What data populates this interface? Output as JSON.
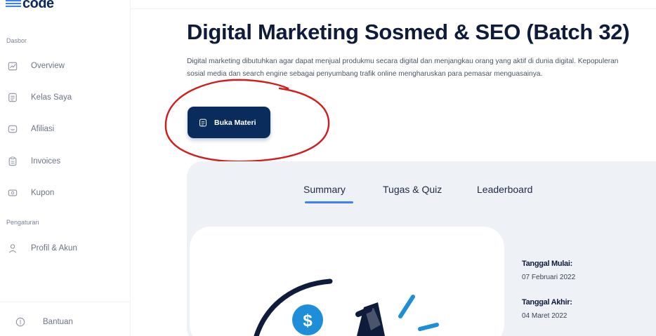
{
  "app": {
    "logo_text": "code"
  },
  "sidebar": {
    "section_dasbor": "Dasbor",
    "section_pengaturan": "Pengaturan",
    "items": [
      {
        "label": "Overview",
        "icon": "chart-icon"
      },
      {
        "label": "Kelas Saya",
        "icon": "document-icon"
      },
      {
        "label": "Afiliasi",
        "icon": "affiliate-icon"
      },
      {
        "label": "Invoices",
        "icon": "clipboard-icon"
      },
      {
        "label": "Kupon",
        "icon": "coupon-icon"
      },
      {
        "label": "Profil & Akun",
        "icon": "user-icon"
      }
    ],
    "help_label": "Bantuan",
    "help_icon": "help-icon"
  },
  "course": {
    "title": "Digital Marketing Sosmed & SEO (Batch 32)",
    "description": "Digital marketing dibutuhkan agar dapat menjual produkmu secara digital dan menjangkau orang yang aktif di dunia digital. Kepopuleran sosial media dan search engine sebagai penyumbang trafik online mengharuskan para pemasar menguasainya.",
    "open_button_label": "Buka Materi",
    "open_button_icon": "document-icon"
  },
  "tabs": [
    {
      "label": "Summary",
      "active": true
    },
    {
      "label": "Tugas & Quiz",
      "active": false
    },
    {
      "label": "Leaderboard",
      "active": false
    }
  ],
  "summary": {
    "start_label": "Tanggal Mulai:",
    "start_value": "07 Februari 2022",
    "end_label": "Tanggal Akhir:",
    "end_value": "04 Maret 2022",
    "illustration": "marketing-megaphone-illustration"
  },
  "colors": {
    "primary": "#0a2c5c",
    "accent": "#3b82f6",
    "annotation": "#d21c1c",
    "panel_bg": "#eef1f6"
  }
}
